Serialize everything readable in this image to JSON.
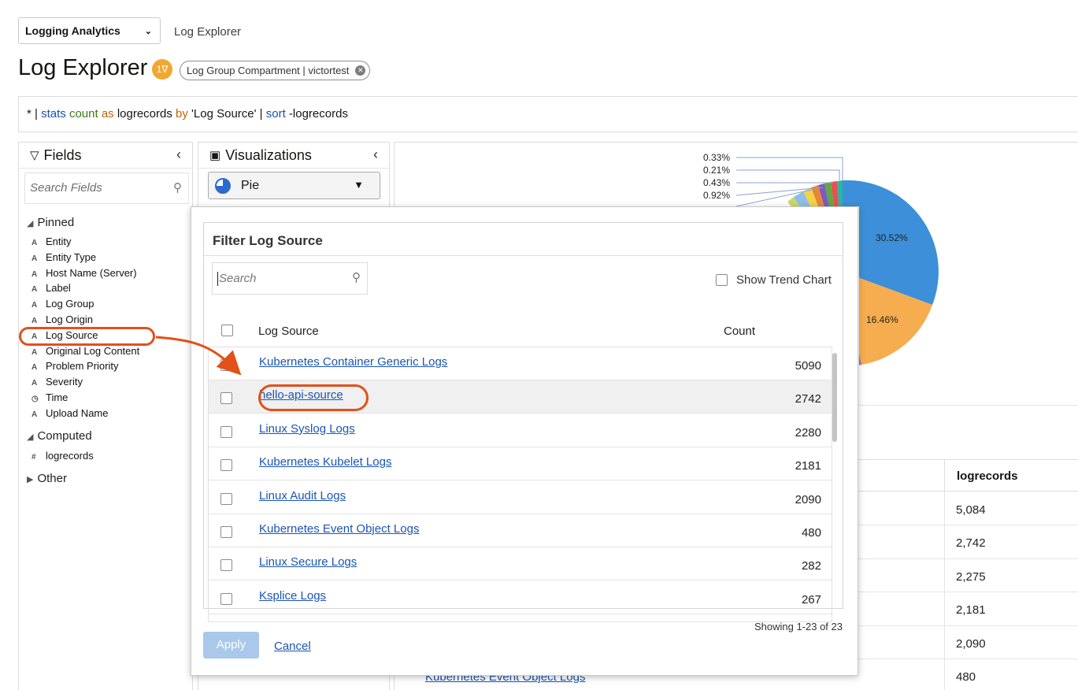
{
  "header": {
    "app_select": "Logging Analytics",
    "breadcrumb": "Log Explorer",
    "title": "Log Explorer",
    "filter_count": "1",
    "chip": "Log Group Compartment | victortest"
  },
  "query": {
    "p1": "* | ",
    "k1": "stats",
    "p2": " ",
    "k2": "count",
    "p3": " ",
    "k3": "as",
    "p4": " logrecords ",
    "k4": "by",
    "p5": " 'Log Source' | ",
    "k5": "sort",
    "p6": " -logrecords"
  },
  "fields_panel": {
    "title": "Fields",
    "search_placeholder": "Search Fields",
    "pinned_label": "Pinned",
    "pinned": [
      {
        "type": "A",
        "label": "Entity"
      },
      {
        "type": "A",
        "label": "Entity Type"
      },
      {
        "type": "A",
        "label": "Host Name (Server)"
      },
      {
        "type": "A",
        "label": "Label"
      },
      {
        "type": "A",
        "label": "Log Group"
      },
      {
        "type": "A",
        "label": "Log Origin"
      },
      {
        "type": "A",
        "label": "Log Source"
      },
      {
        "type": "A",
        "label": "Original Log Content"
      },
      {
        "type": "A",
        "label": "Problem Priority"
      },
      {
        "type": "A",
        "label": "Severity"
      },
      {
        "type": "◷",
        "label": "Time"
      },
      {
        "type": "A",
        "label": "Upload Name"
      }
    ],
    "computed_label": "Computed",
    "computed": [
      {
        "type": "#",
        "label": "logrecords"
      }
    ],
    "other_label": "Other"
  },
  "viz_panel": {
    "title": "Visualizations",
    "selected": "Pie"
  },
  "chart": {
    "labels": [
      "0.33%",
      "0.21%",
      "0.43%",
      "0.92%",
      "30.52%",
      "16.46%"
    ]
  },
  "results_table": {
    "header": "logrecords",
    "values": [
      "5,084",
      "2,742",
      "2,275",
      "2,181",
      "2,090",
      "480"
    ],
    "bottom_link": "Kubernetes Event Object Logs"
  },
  "dialog": {
    "title": "Filter Log Source",
    "search_placeholder": "Search",
    "trend_label": "Show Trend Chart",
    "col_source": "Log Source",
    "col_count": "Count",
    "rows": [
      {
        "name": "Kubernetes Container Generic Logs",
        "count": "5090"
      },
      {
        "name": "hello-api-source",
        "count": "2742"
      },
      {
        "name": "Linux Syslog Logs",
        "count": "2280"
      },
      {
        "name": "Kubernetes Kubelet Logs",
        "count": "2181"
      },
      {
        "name": "Linux Audit Logs",
        "count": "2090"
      },
      {
        "name": "Kubernetes Event Object Logs",
        "count": "480"
      },
      {
        "name": "Linux Secure Logs",
        "count": "282"
      },
      {
        "name": "Ksplice Logs",
        "count": "267"
      }
    ],
    "showing": "Showing 1-23 of 23",
    "apply": "Apply",
    "cancel": "Cancel"
  },
  "colors": {
    "accent_blue": "#1a55b3",
    "highlight_orange": "#e2511a",
    "pie_blue": "#3c8fd8",
    "pie_orange": "#f5ad4f"
  }
}
